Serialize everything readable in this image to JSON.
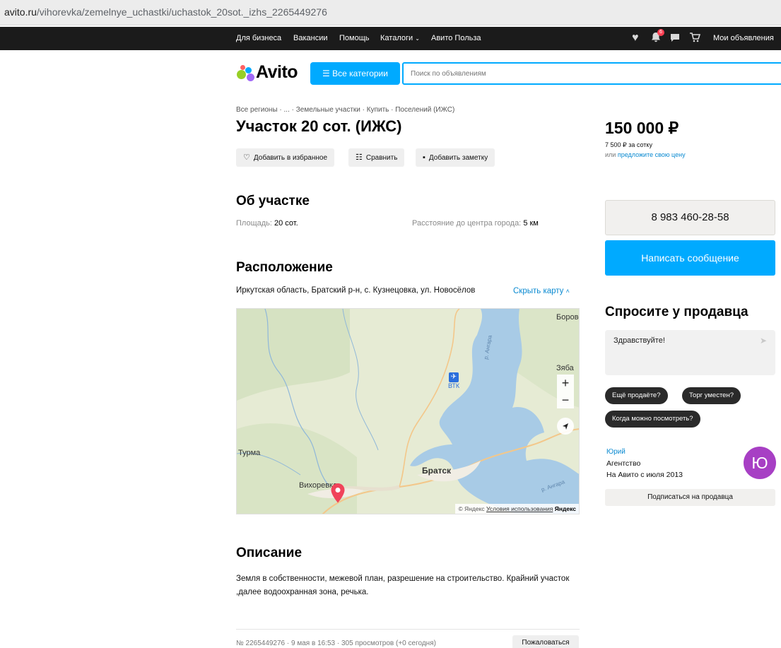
{
  "browser": {
    "url_domain": "avito.ru",
    "url_path": "/vihorevka/zemelnye_uchastki/uchastok_20sot._izhs_2265449276"
  },
  "topnav": {
    "links": [
      "Для бизнеса",
      "Вакансии",
      "Помощь",
      "Каталоги",
      "Авито Польза"
    ],
    "notifications_count": "6",
    "my_ads": "Мои объявления"
  },
  "header": {
    "logo_text": "Avito",
    "categories_button": "Все категории",
    "search_placeholder": "Поиск по объявлениям"
  },
  "listing": {
    "breadcrumbs": "Все регионы · ... · Земельные участки · Купить · Поселений (ИЖС)",
    "title": "Участок 20 сот. (ИЖС)",
    "actions": {
      "favorite": "Добавить в избранное",
      "compare": "Сравнить",
      "note": "Добавить заметку"
    },
    "about_title": "Об участке",
    "params": {
      "area_label": "Площадь:",
      "area_value": "20 сот.",
      "distance_label": "Расстояние до центра города:",
      "distance_value": "5 км"
    },
    "location_title": "Расположение",
    "address": "Иркутская область, Братский р-н, с. Кузнецовка, ул. Новосёлов",
    "hide_map": "Скрыть карту",
    "map": {
      "labels": {
        "borovskoy": "Боровс",
        "zyaba": "Зяба",
        "vtk": "ВТК",
        "angara_north": "р. Ангара",
        "turma": "Турма",
        "bratsk": "Братск",
        "vikhorevka": "Вихоревка",
        "angara_south": "р. Ангара"
      },
      "copyright": "© Яндекс",
      "terms": "Условия использования",
      "brand": "Яндекс"
    },
    "description_title": "Описание",
    "description": "Земля в собственности, межевой план, разрешение на строительство. Крайний участок ,далее водоохранная зона, речька.",
    "footer_meta": "№ 2265449276 · 9 мая в 16:53 · 305 просмотров (+0 сегодня)",
    "complain": "Пожаловаться"
  },
  "sidebar": {
    "price": "150 000 ₽",
    "price_per_sotka": "7 500 ₽ за сотку",
    "offer_prefix": "или",
    "offer_link": "предложите свою цену",
    "phone": "8 983 460-28-58",
    "message_button": "Написать сообщение",
    "ask_title": "Спросите у продавца",
    "ask_message": "Здравствуйте!",
    "quick_questions": [
      "Ещё продаёте?",
      "Торг уместен?",
      "Когда можно посмотреть?"
    ],
    "seller": {
      "name": "Юрий",
      "type": "Агентство",
      "since": "На Авито с июля 2013",
      "avatar_letter": "Ю",
      "subscribe": "Подписаться на продавца"
    }
  },
  "colors": {
    "accent": "#00aaff",
    "link": "#0a8ad1",
    "nav_bg": "#1b1b1b",
    "avatar": "#a73fc4",
    "map_pin": "#f0435a"
  }
}
